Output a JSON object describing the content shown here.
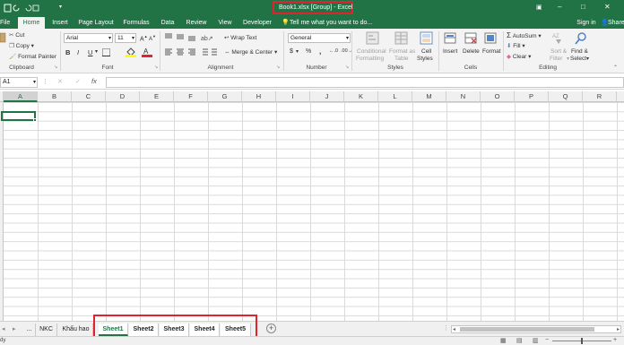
{
  "window": {
    "title": "Book1.xlsx  [Group] - Excel"
  },
  "tabs": [
    "File",
    "Home",
    "Insert",
    "Page Layout",
    "Formulas",
    "Data",
    "Review",
    "View",
    "Developer"
  ],
  "tell_me": "Tell me what you want to do...",
  "account": {
    "sign_in": "Sign in",
    "share": "Share"
  },
  "clipboard": {
    "cut": "Cut",
    "copy": "Copy",
    "format_painter": "Format Painter",
    "group": "Clipboard"
  },
  "font": {
    "name": "Arial",
    "size": "11",
    "bold": "B",
    "italic": "I",
    "underline": "U",
    "group": "Font"
  },
  "alignment": {
    "wrap": "Wrap Text",
    "merge": "Merge & Center",
    "group": "Alignment"
  },
  "number": {
    "format": "General",
    "currency": "$",
    "percent": "%",
    "comma": ",",
    "group": "Number"
  },
  "styles": {
    "conditional_1": "Conditional",
    "conditional_2": "Formatting",
    "format_table_1": "Format as",
    "format_table_2": "Table",
    "cell_styles_1": "Cell",
    "cell_styles_2": "Styles",
    "group": "Styles"
  },
  "cells": {
    "insert": "Insert",
    "delete": "Delete",
    "format": "Format",
    "group": "Cells"
  },
  "editing": {
    "autosum": "AutoSum",
    "fill": "Fill",
    "clear": "Clear",
    "sort_1": "Sort &",
    "sort_2": "Filter",
    "find_1": "Find &",
    "find_2": "Select",
    "group": "Editing"
  },
  "formula_bar": {
    "name_box": "A1",
    "cancel": "✕",
    "enter": "✓",
    "fx": "fx",
    "formula": ""
  },
  "columns": [
    "A",
    "B",
    "C",
    "D",
    "E",
    "F",
    "G",
    "H",
    "I",
    "J",
    "K",
    "L",
    "M",
    "N",
    "O",
    "P",
    "Q",
    "R"
  ],
  "sheet_tabs": {
    "ellipsis": "...",
    "other": [
      "NKC",
      "Khấu hao"
    ],
    "grouped": [
      "Sheet1",
      "Sheet2",
      "Sheet3",
      "Sheet4",
      "Sheet5"
    ],
    "add": "+"
  },
  "status": {
    "text": "dy"
  },
  "colors": {
    "excel_green": "#217346",
    "highlight": "#e0232e"
  }
}
